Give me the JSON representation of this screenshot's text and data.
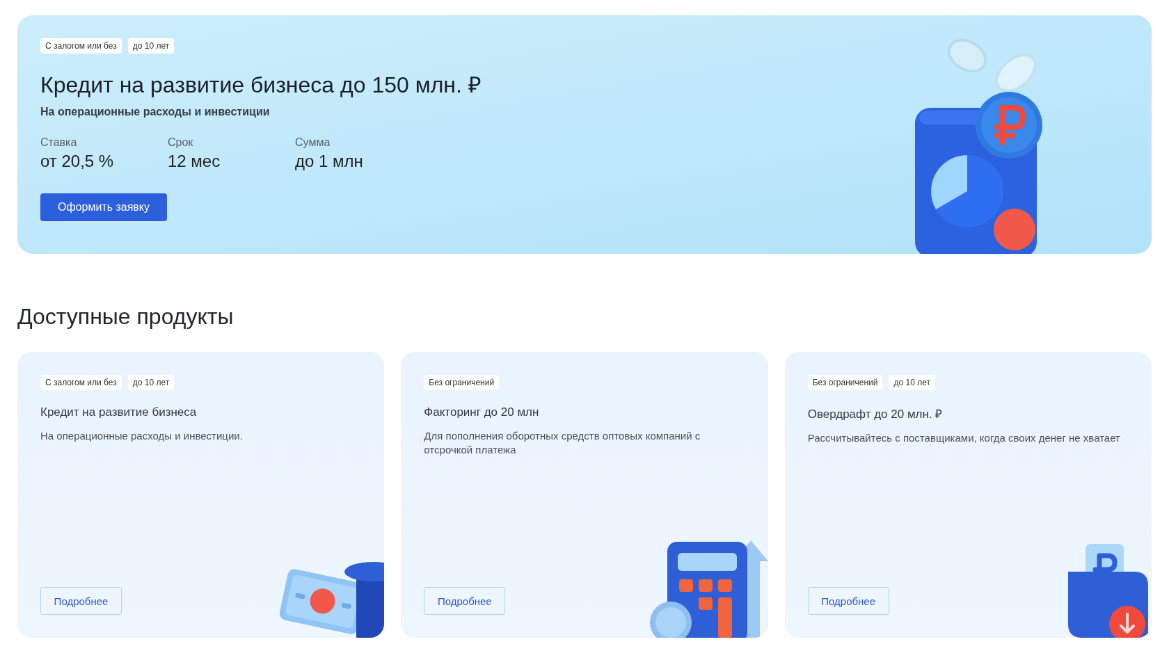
{
  "banner": {
    "tags": [
      "С залогом или без",
      "до 10 лет"
    ],
    "title": "Кредит на развитие бизнеса до 150 млн. ₽",
    "subtitle": "На операционные расходы и инвестиции",
    "stats": [
      {
        "label": "Ставка",
        "value": "от 20,5 %"
      },
      {
        "label": "Срок",
        "value": "12 мес"
      },
      {
        "label": "Сумма",
        "value": "до 1 млн"
      }
    ],
    "button": "Оформить заявку"
  },
  "section_title": "Доступные продукты",
  "products": [
    {
      "tags": [
        "С залогом или без",
        "до 10 лет"
      ],
      "title": "Кредит на развитие бизнеса",
      "description": "На операционные расходы и инвестиции.",
      "button": "Подробнее"
    },
    {
      "tags": [
        "Без ограничений"
      ],
      "title": "Факторинг до 20 млн",
      "description": "Для пополнения оборотных средств оптовых компаний с отсрочкой платежа",
      "button": "Подробнее"
    },
    {
      "tags": [
        "Без ограничений",
        "до 10 лет"
      ],
      "title": "Овердрафт до 20 млн. ₽",
      "description": "Рассчитывайтесь с поставщиками, когда своих денег не хватает",
      "button": "Подробнее"
    }
  ]
}
